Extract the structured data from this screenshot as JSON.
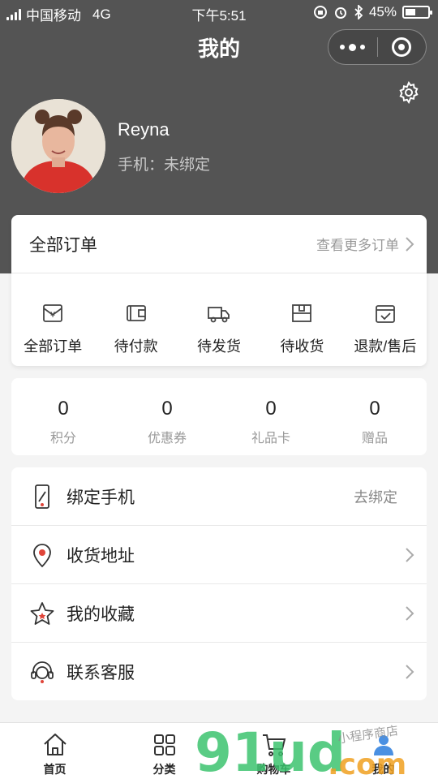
{
  "status_bar": {
    "carrier": "中国移动",
    "network": "4G",
    "time": "下午5:51",
    "battery": "45%",
    "battery_level": 0.45
  },
  "nav": {
    "title": "我的"
  },
  "profile": {
    "name": "Reyna",
    "phone_label": "手机：未绑定"
  },
  "orders": {
    "title": "全部订单",
    "more": "查看更多订单",
    "items": [
      {
        "label": "全部订单",
        "icon": "all-orders-icon"
      },
      {
        "label": "待付款",
        "icon": "wallet-icon"
      },
      {
        "label": "待发货",
        "icon": "truck-icon"
      },
      {
        "label": "待收货",
        "icon": "package-icon"
      },
      {
        "label": "退款/售后",
        "icon": "refund-icon"
      }
    ]
  },
  "stats": [
    {
      "value": "0",
      "label": "积分"
    },
    {
      "value": "0",
      "label": "优惠券"
    },
    {
      "value": "0",
      "label": "礼品卡"
    },
    {
      "value": "0",
      "label": "赠品"
    }
  ],
  "menu": [
    {
      "label": "绑定手机",
      "right": "去绑定",
      "icon": "phone-icon"
    },
    {
      "label": "收货地址",
      "right": "",
      "icon": "location-pin-icon"
    },
    {
      "label": "我的收藏",
      "right": "",
      "icon": "star-icon"
    },
    {
      "label": "联系客服",
      "right": "",
      "icon": "headset-icon"
    }
  ],
  "tabbar": [
    {
      "label": "首页",
      "icon": "home-icon"
    },
    {
      "label": "分类",
      "icon": "grid-icon"
    },
    {
      "label": "购物车",
      "icon": "cart-icon"
    },
    {
      "label": "我的",
      "icon": "user-icon"
    }
  ],
  "watermark": {
    "text": "91ud",
    "suffix": ".com",
    "tagline": "小程序商店"
  },
  "colors": {
    "header": "#545454",
    "accent_red": "#e0453a",
    "watermark_green": "#3cc36f"
  }
}
